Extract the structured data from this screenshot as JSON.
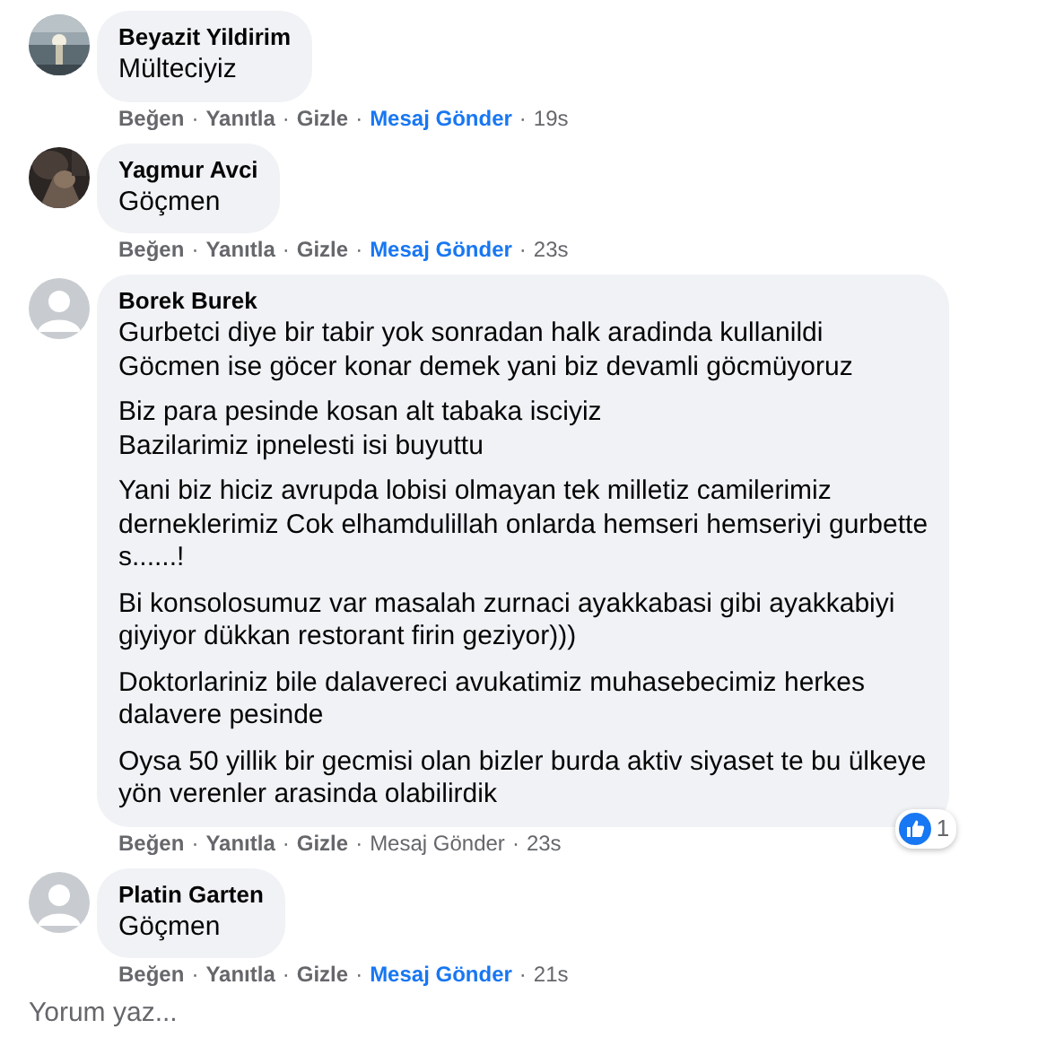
{
  "comments": [
    {
      "author": "Beyazit Yildirim",
      "avatar": {
        "kind": "picture"
      },
      "paragraphs": [
        [
          "Mülteciyiz"
        ]
      ],
      "actions": [
        "Beğen",
        "Yanıtla",
        "Gizle"
      ],
      "message": {
        "label": "Mesaj Gönder",
        "highlighted": true
      },
      "time": "19s"
    },
    {
      "author": "Yagmur Avci",
      "avatar": {
        "kind": "picture"
      },
      "paragraphs": [
        [
          "Göçmen"
        ]
      ],
      "actions": [
        "Beğen",
        "Yanıtla",
        "Gizle"
      ],
      "message": {
        "label": "Mesaj Gönder",
        "highlighted": true
      },
      "time": "23s"
    },
    {
      "author": "Borek Burek",
      "avatar": {
        "kind": "default"
      },
      "paragraphs": [
        [
          "Gurbetci diye bir tabir yok sonradan halk aradinda kullanildi",
          "Göcmen ise göcer konar demek yani biz devamli göcmüyoruz"
        ],
        [
          "Biz para pesinde kosan alt tabaka isciyiz",
          "Bazilarimiz ipnelesti isi buyuttu"
        ],
        [
          "Yani biz hiciz avrupda lobisi olmayan tek milletiz camilerimiz",
          "derneklerimiz Cok elhamdulillah onlarda hemseri hemseriyi gurbette",
          "s......!"
        ],
        [
          "Bi konsolosumuz var masalah zurnaci ayakkabasi gibi ayakkabiyi",
          "giyiyor dükkan restorant firin geziyor)))"
        ],
        [
          "Doktorlariniz bile dalavereci avukatimiz muhasebecimiz herkes",
          "dalavere pesinde"
        ],
        [
          "Oysa 50 yillik bir gecmisi olan bizler burda aktiv siyaset te bu ülkeye",
          "yön verenler arasinda olabilirdik"
        ]
      ],
      "reaction": {
        "count": "1"
      },
      "actions": [
        "Beğen",
        "Yanıtla",
        "Gizle"
      ],
      "message": {
        "label": "Mesaj Gönder",
        "highlighted": false
      },
      "time": "23s"
    },
    {
      "author": "Platin Garten",
      "avatar": {
        "kind": "default"
      },
      "paragraphs": [
        [
          "Göçmen"
        ]
      ],
      "actions": [
        "Beğen",
        "Yanıtla",
        "Gizle"
      ],
      "message": {
        "label": "Mesaj Gönder",
        "highlighted": true
      },
      "time": "21s"
    }
  ],
  "separator": "·",
  "composer": {
    "placeholder": "Yorum yaz..."
  }
}
